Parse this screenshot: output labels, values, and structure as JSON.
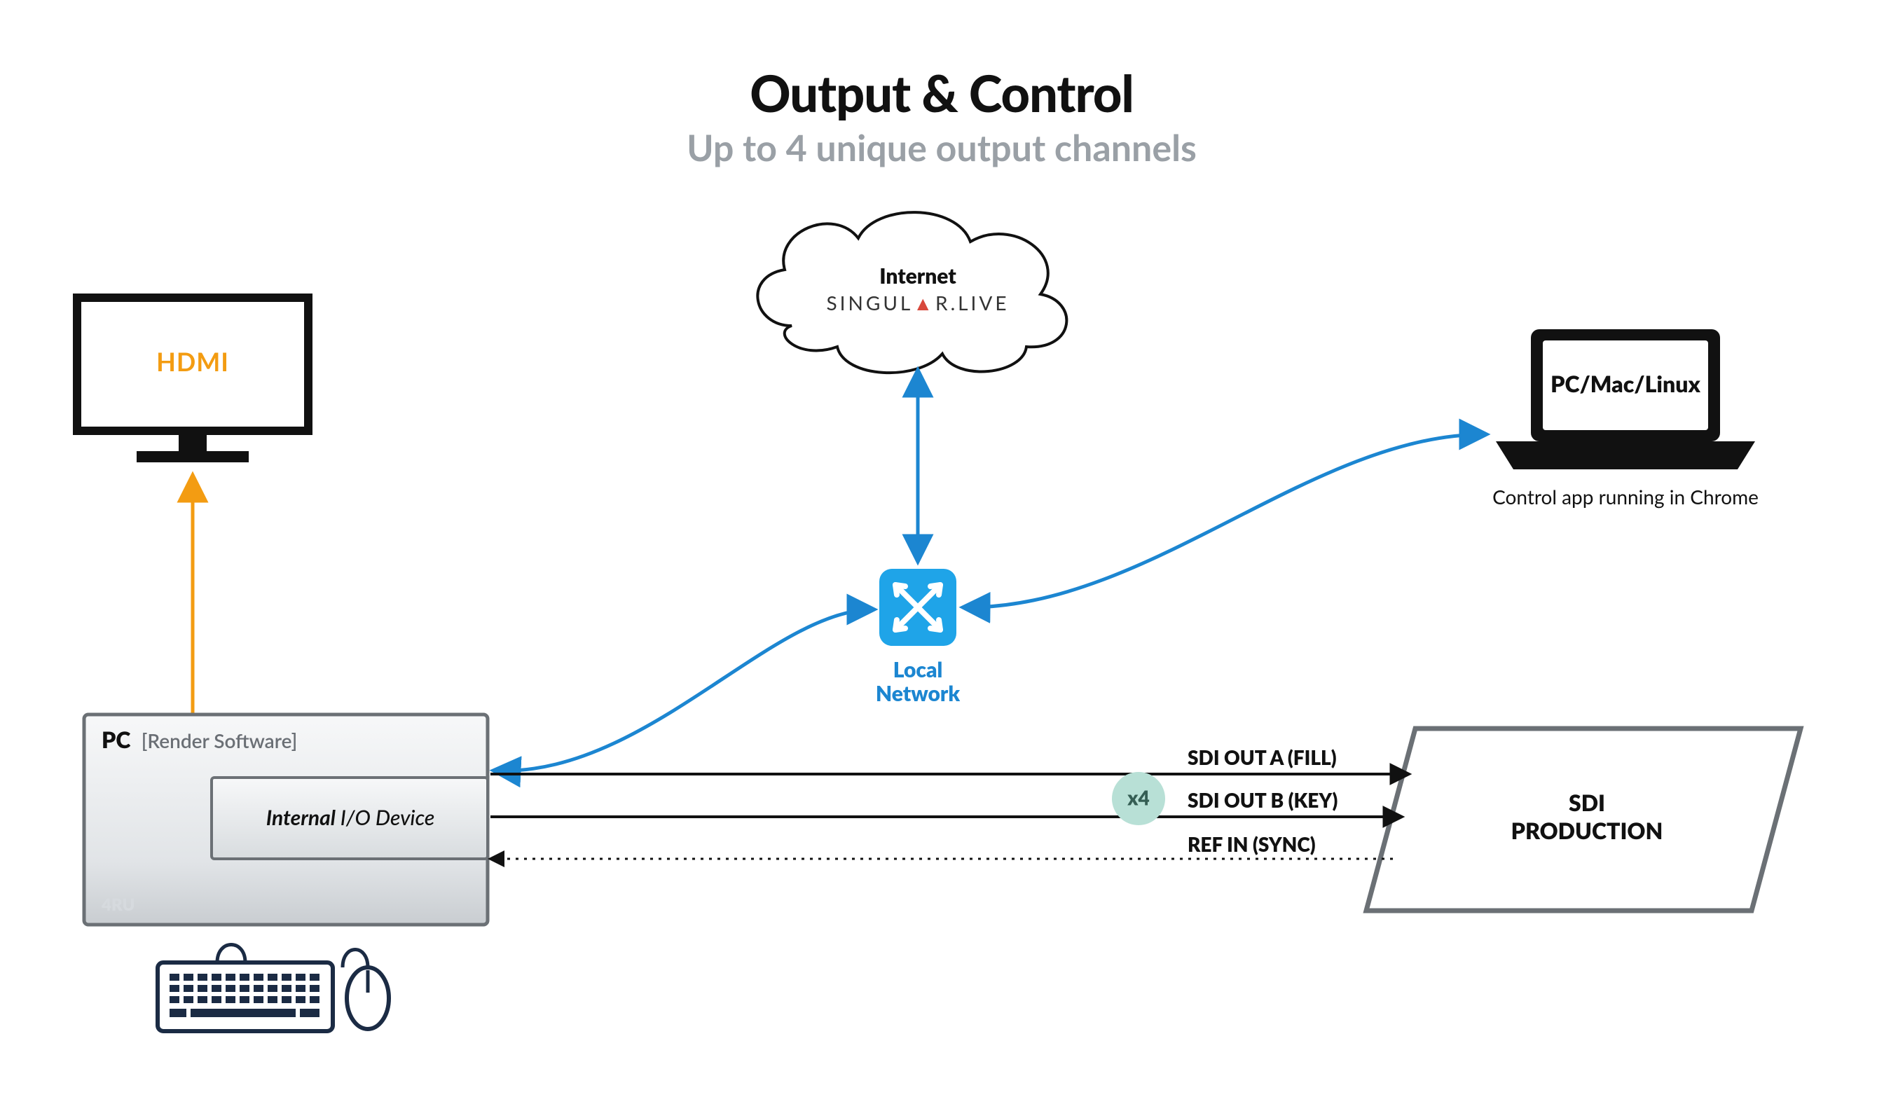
{
  "title": "Output & Control",
  "subtitle": "Up to 4 unique output channels",
  "monitor": {
    "label": "HDMI"
  },
  "cloud": {
    "title": "Internet",
    "brand_left": "SINGUL",
    "brand_right": "R.LIVE"
  },
  "network": {
    "label_line1": "Local",
    "label_line2": "Network"
  },
  "laptop": {
    "title": "PC/Mac/Linux",
    "caption": "Control app running in Chrome"
  },
  "pc_box": {
    "title": "PC",
    "subtitle": "[Render Software]",
    "io_label_italic": "Internal",
    "io_label_rest": " I/O Device",
    "footer": "4RU"
  },
  "badge": "x4",
  "sdi": {
    "out_a": "SDI OUT A (FILL)",
    "out_b": "SDI OUT B (KEY)",
    "ref_in": "REF IN (SYNC)"
  },
  "sdi_production": {
    "line1": "SDI",
    "line2": "PRODUCTION"
  },
  "colors": {
    "blue": "#1c86d1",
    "orange": "#f39c12",
    "grey_border": "#6b7075",
    "badge_bg": "#b8e0d6"
  }
}
